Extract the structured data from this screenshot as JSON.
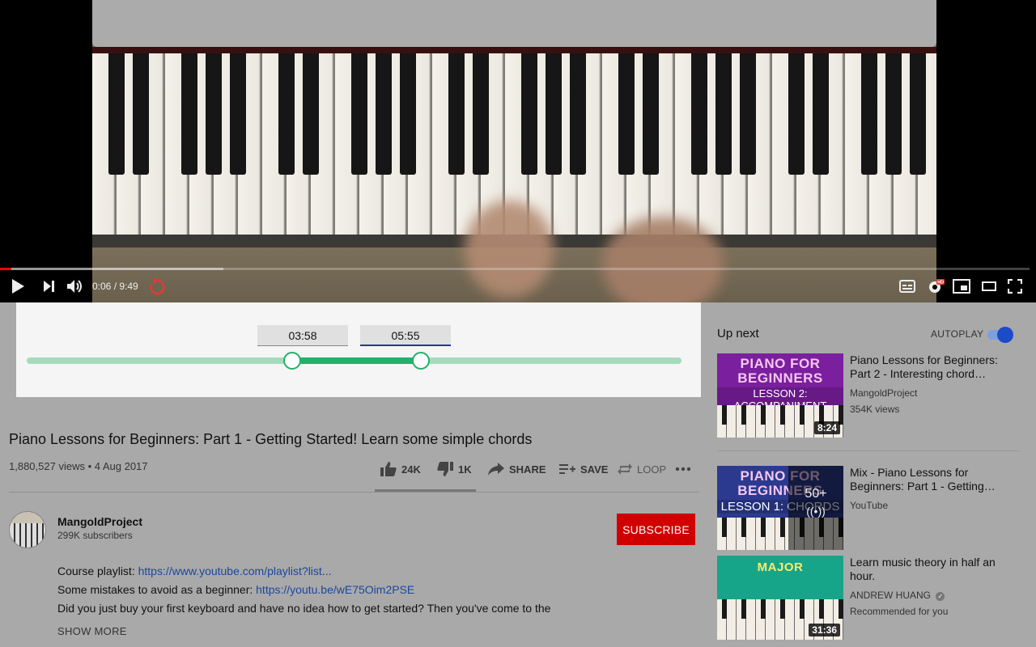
{
  "player": {
    "time_display": "0:06 / 9:49",
    "progress": {
      "played_fraction": 0.011,
      "buffered_fraction": 0.217
    }
  },
  "loop_editor": {
    "start_time": "03:58",
    "end_time": "05:55",
    "start_fraction": 0.405,
    "end_fraction": 0.602
  },
  "video": {
    "title": "Piano Lessons for Beginners: Part 1 - Getting Started! Learn some simple chords",
    "views_date": "1,880,527 views • 4 Aug 2017",
    "actions": {
      "likes": "24K",
      "dislikes": "1K",
      "share": "SHARE",
      "save": "SAVE",
      "loop": "LOOP"
    }
  },
  "channel": {
    "name": "MangoldProject",
    "subscribers": "299K subscribers",
    "subscribe_label": "SUBSCRIBE"
  },
  "description": {
    "line1_prefix": "Course playlist: ",
    "line1_link": "https://www.youtube.com/playlist?list...",
    "line2_prefix": "Some mistakes to avoid as a beginner: ",
    "line2_link": "https://youtu.be/wE75Oim2PSE",
    "line3": "Did you just buy your first keyboard and have no idea how to get started? Then you've come to the",
    "show_more": "SHOW MORE"
  },
  "sidebar": {
    "up_next_label": "Up next",
    "autoplay_label": "AUTOPLAY",
    "autoplay_on": true,
    "items": [
      {
        "title": "Piano Lessons for Beginners: Part 2 - Interesting chord…",
        "channel": "MangoldProject",
        "meta": "354K views",
        "duration": "8:24",
        "thumb_title": "PIANO FOR BEGINNERS",
        "thumb_sub": "LESSON 2: ACCOMPANIMENT",
        "thumb_color": "#7a1f9e"
      },
      {
        "title": "Mix - Piano Lessons for Beginners: Part 1 - Getting…",
        "channel": "YouTube",
        "meta": "",
        "mix_count": "50+",
        "thumb_title": "PIANO FOR BEGINNERS",
        "thumb_sub": "LESSON 1: CHORDS",
        "thumb_color": "#2b3a8f"
      },
      {
        "title": "Learn music theory in half an hour.",
        "channel": "ANDREW HUANG",
        "meta": "Recommended for you",
        "duration": "31:36",
        "thumb_title": "MAJOR",
        "thumb_color": "#17a589"
      }
    ]
  }
}
